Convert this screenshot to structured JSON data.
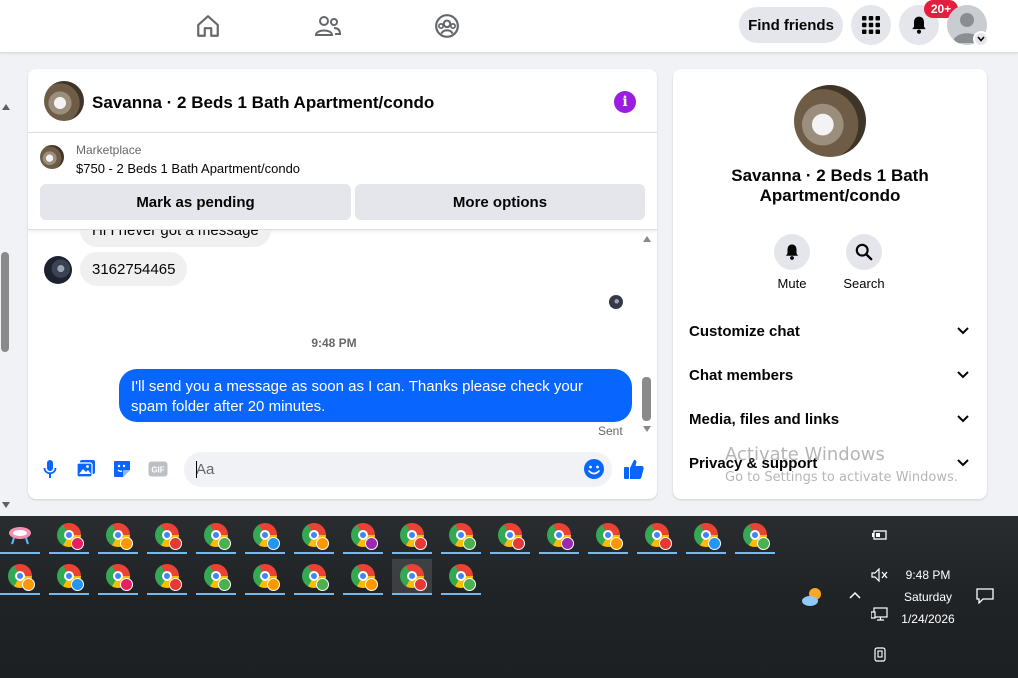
{
  "topnav": {
    "icons": [
      "home-icon",
      "friends-icon",
      "groups-icon"
    ],
    "find_friends_label": "Find friends",
    "notifications_badge": "20+"
  },
  "chat": {
    "title": "Savanna · 2 Beds 1 Bath Apartment/condo",
    "marketplace_label": "Marketplace",
    "listing": "$750 - 2 Beds 1 Bath Apartment/condo",
    "mark_pending_label": "Mark as pending",
    "more_options_label": "More options",
    "messages": {
      "partial_incoming": "Hi I never got a message",
      "incoming": "3162754465",
      "timestamp": "9:48 PM",
      "outgoing": "I'll send you a message as soon as I can. Thanks please check your spam folder after 20 minutes.",
      "status": "Sent"
    },
    "composer_placeholder": "Aa",
    "composer_icons": [
      "microphone-icon",
      "photo-icon",
      "sticker-icon",
      "gif-icon",
      "emoji-icon",
      "like-icon"
    ]
  },
  "info_panel": {
    "title": "Savanna · 2 Beds 1 Bath Apartment/condo",
    "mute_label": "Mute",
    "search_label": "Search",
    "sections": [
      "Customize chat",
      "Chat members",
      "Media, files and links",
      "Privacy & support"
    ]
  },
  "watermark": {
    "line1": "Activate Windows",
    "line2": "Go to Settings to activate Windows."
  },
  "taskbar": {
    "time": "9:48 PM",
    "day": "Saturday",
    "date": "1/24/2026",
    "profile_colors": [
      "#e91e63",
      "#ff9800",
      "#e53935",
      "#4caf50",
      "#2196f3",
      "#ff9800",
      "#9c27b0",
      "#e53935",
      "#4caf50",
      "#e53935",
      "#9c27b0",
      "#ff9800",
      "#e53935",
      "#2196f3",
      "#4caf50",
      "#ff9800",
      "#2196f3",
      "#e91e63",
      "#e53935",
      "#4caf50",
      "#ff9800",
      "#4caf50",
      "#ff9800",
      "#e53935",
      "#4caf50"
    ]
  }
}
